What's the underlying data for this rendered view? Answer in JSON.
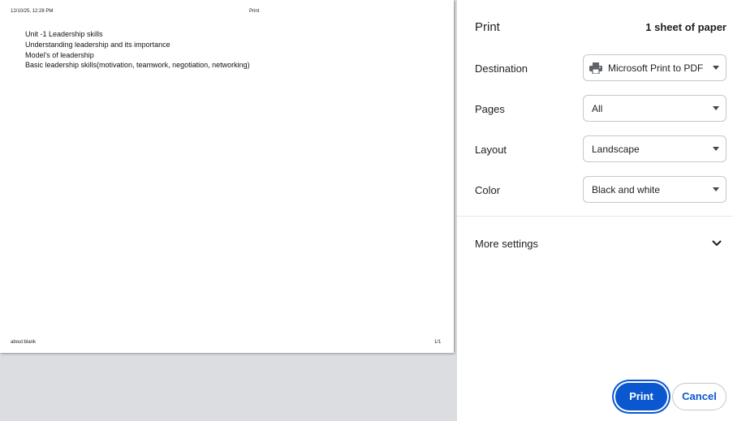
{
  "preview": {
    "header_left": "12/10/25, 12:28 PM",
    "header_center": "Print",
    "lines": [
      "Unit -1 Leadership skills",
      "Understanding leadership and its importance",
      "Model's of leadership",
      "Basic leadership skills(motivation, teamwork, negotiation, networking)"
    ],
    "footer_left": "about:blank",
    "footer_right": "1/1"
  },
  "panel": {
    "title": "Print",
    "sheet_count": "1 sheet of paper",
    "destination": {
      "label": "Destination",
      "value": "Microsoft Print to PDF",
      "icon": "printer-icon"
    },
    "pages": {
      "label": "Pages",
      "value": "All"
    },
    "layout": {
      "label": "Layout",
      "value": "Landscape"
    },
    "color": {
      "label": "Color",
      "value": "Black and white"
    },
    "more_settings": {
      "label": "More settings",
      "icon": "chevron-down-icon"
    }
  },
  "buttons": {
    "print": "Print",
    "cancel": "Cancel"
  },
  "colors": {
    "accent": "#0b57d0",
    "preview_background": "#dcdde0"
  }
}
